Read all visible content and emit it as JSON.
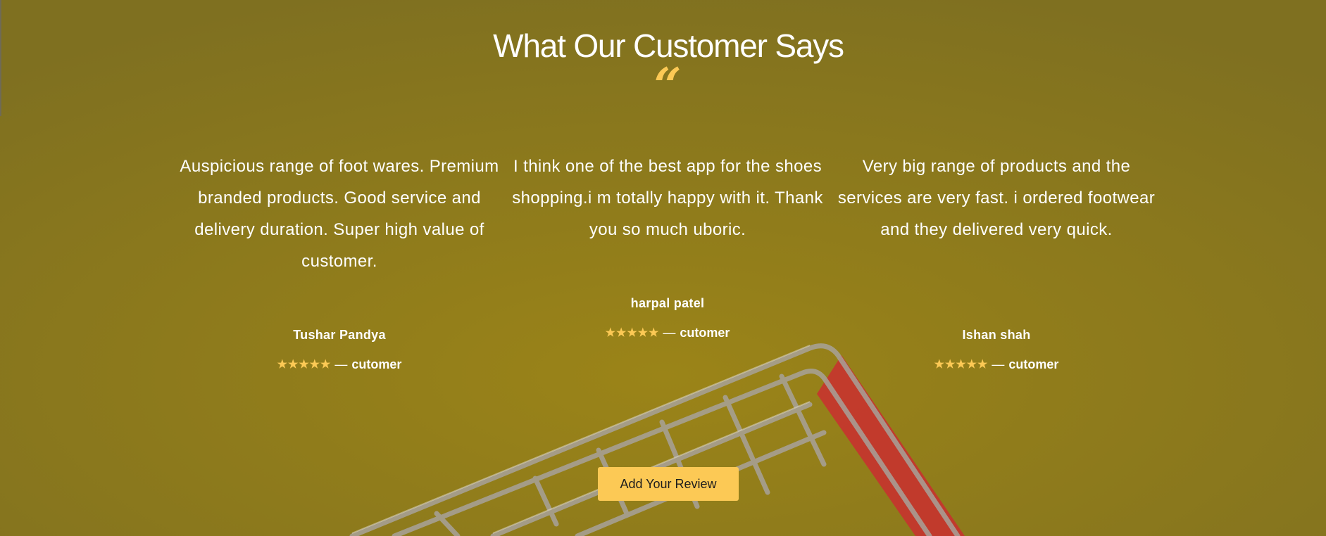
{
  "section": {
    "title": "What Our Customer Says",
    "quote_icon": "quote-open-icon"
  },
  "reviews": [
    {
      "text": "Auspicious range of foot wares. Premium branded products. Good service and delivery duration. Super high value of customer.",
      "name": "Tushar Pandya",
      "rating": 5,
      "role": "cutomer",
      "separator": "—"
    },
    {
      "text": "I think one of the best app for the shoes shopping.i m totally happy with it. Thank you so much uboric.",
      "name": "harpal patel",
      "rating": 5,
      "role": "cutomer",
      "separator": "—"
    },
    {
      "text": "Very big range of products and the services are very fast. i ordered footwear and they delivered very quick.",
      "name": "Ishan shah",
      "rating": 5,
      "role": "cutomer",
      "separator": "—"
    }
  ],
  "cta": {
    "label": "Add Your Review"
  },
  "colors": {
    "background": "#8a7619",
    "accent": "#fcc955",
    "text": "#ffffff",
    "cart_handle": "#c7332f"
  },
  "background_image": "shopping-cart-image"
}
